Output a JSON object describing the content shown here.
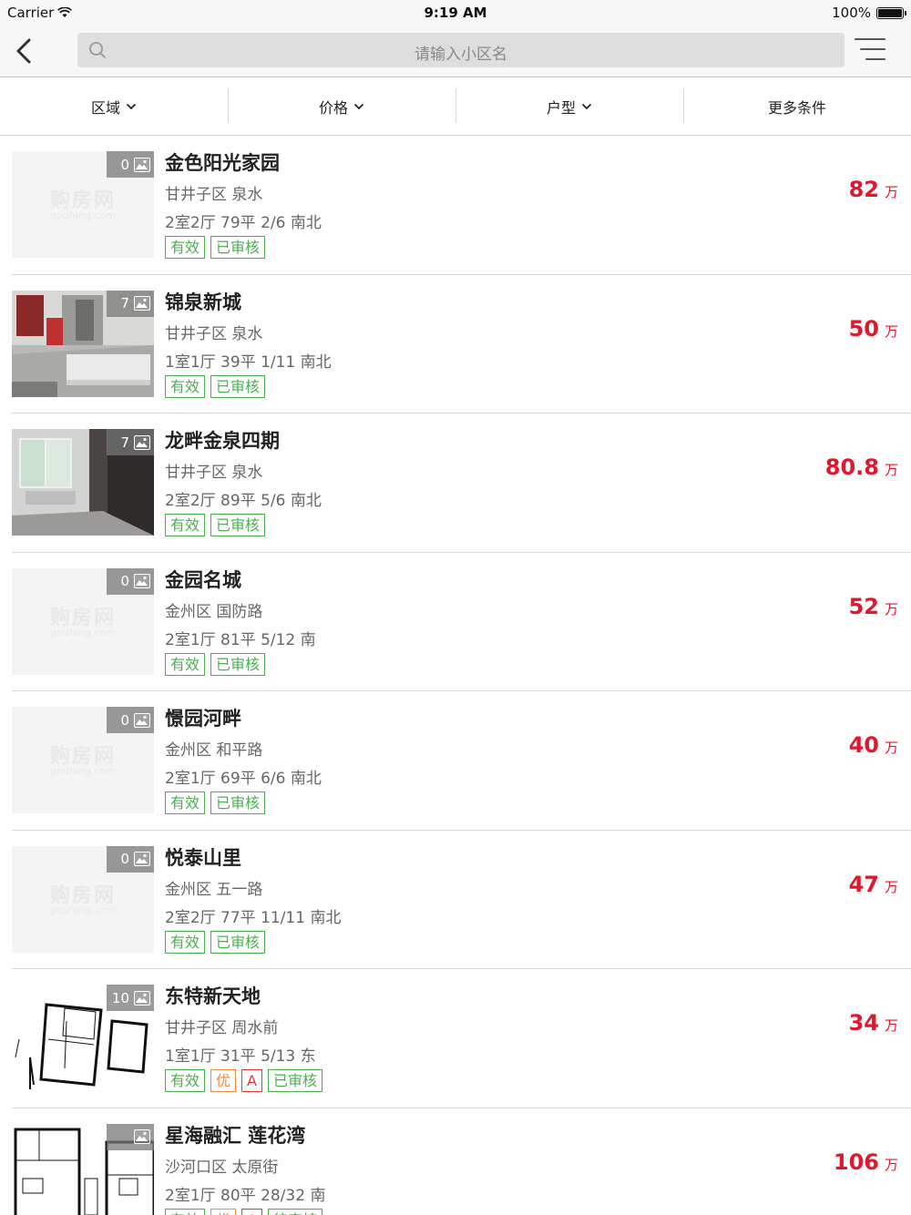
{
  "status_bar": {
    "carrier": "Carrier",
    "time": "9:19 AM",
    "battery": "100%",
    "battery_level": 1.0
  },
  "nav": {
    "search_placeholder": "请输入小区名"
  },
  "filters": [
    {
      "label": "区域",
      "has_dropdown": true
    },
    {
      "label": "价格",
      "has_dropdown": true
    },
    {
      "label": "户型",
      "has_dropdown": true
    },
    {
      "label": "更多条件",
      "has_dropdown": false
    }
  ],
  "watermark": {
    "text": "购房网",
    "sub": "goufang.com"
  },
  "listings": [
    {
      "title": "金色阳光家园",
      "location": "甘井子区 泉水",
      "specs": "2室2厅 79平 2/6 南北",
      "photos": "0",
      "price": "82",
      "unit": "万",
      "image": "placeholder",
      "tags": [
        {
          "text": "有效",
          "color": "green"
        },
        {
          "text": "已审核",
          "color": "green"
        }
      ]
    },
    {
      "title": "锦泉新城",
      "location": "甘井子区 泉水",
      "specs": "1室1厅 39平 1/11 南北",
      "photos": "7",
      "price": "50",
      "unit": "万",
      "image": "room-photo",
      "tags": [
        {
          "text": "有效",
          "color": "green"
        },
        {
          "text": "已审核",
          "color": "green"
        }
      ]
    },
    {
      "title": "龙畔金泉四期",
      "location": "甘井子区 泉水",
      "specs": "2室2厅 89平 5/6 南北",
      "photos": "7",
      "price": "80.8",
      "unit": "万",
      "image": "window-photo",
      "tags": [
        {
          "text": "有效",
          "color": "green"
        },
        {
          "text": "已审核",
          "color": "green"
        }
      ]
    },
    {
      "title": "金园名城",
      "location": "金州区 国防路",
      "specs": "2室1厅 81平 5/12 南",
      "photos": "0",
      "price": "52",
      "unit": "万",
      "image": "placeholder",
      "tags": [
        {
          "text": "有效",
          "color": "green"
        },
        {
          "text": "已审核",
          "color": "green"
        }
      ]
    },
    {
      "title": "憬园河畔",
      "location": "金州区 和平路",
      "specs": "2室1厅 69平 6/6 南北",
      "photos": "0",
      "price": "40",
      "unit": "万",
      "image": "placeholder",
      "tags": [
        {
          "text": "有效",
          "color": "green"
        },
        {
          "text": "已审核",
          "color": "green"
        }
      ]
    },
    {
      "title": "悦泰山里",
      "location": "金州区 五一路",
      "specs": "2室2厅 77平 11/11 南北",
      "photos": "0",
      "price": "47",
      "unit": "万",
      "image": "placeholder",
      "tags": [
        {
          "text": "有效",
          "color": "green"
        },
        {
          "text": "已审核",
          "color": "green"
        }
      ]
    },
    {
      "title": "东特新天地",
      "location": "甘井子区 周水前",
      "specs": "1室1厅 31平 5/13 东",
      "photos": "10",
      "price": "34",
      "unit": "万",
      "image": "floorplan-a",
      "tags": [
        {
          "text": "有效",
          "color": "green"
        },
        {
          "text": "优",
          "color": "orange"
        },
        {
          "text": "A",
          "color": "red"
        },
        {
          "text": "已审核",
          "color": "green"
        }
      ]
    },
    {
      "title": "星海融汇 莲花湾",
      "location": "沙河口区 太原街",
      "specs": "2室1厅 80平 28/32 南",
      "photos": "",
      "price": "106",
      "unit": "万",
      "image": "floorplan-b",
      "tags": [
        {
          "text": "有效",
          "color": "green"
        },
        {
          "text": "优",
          "color": "orange"
        },
        {
          "text": "A",
          "color": "red"
        },
        {
          "text": "待审核",
          "color": "green"
        }
      ]
    }
  ]
}
